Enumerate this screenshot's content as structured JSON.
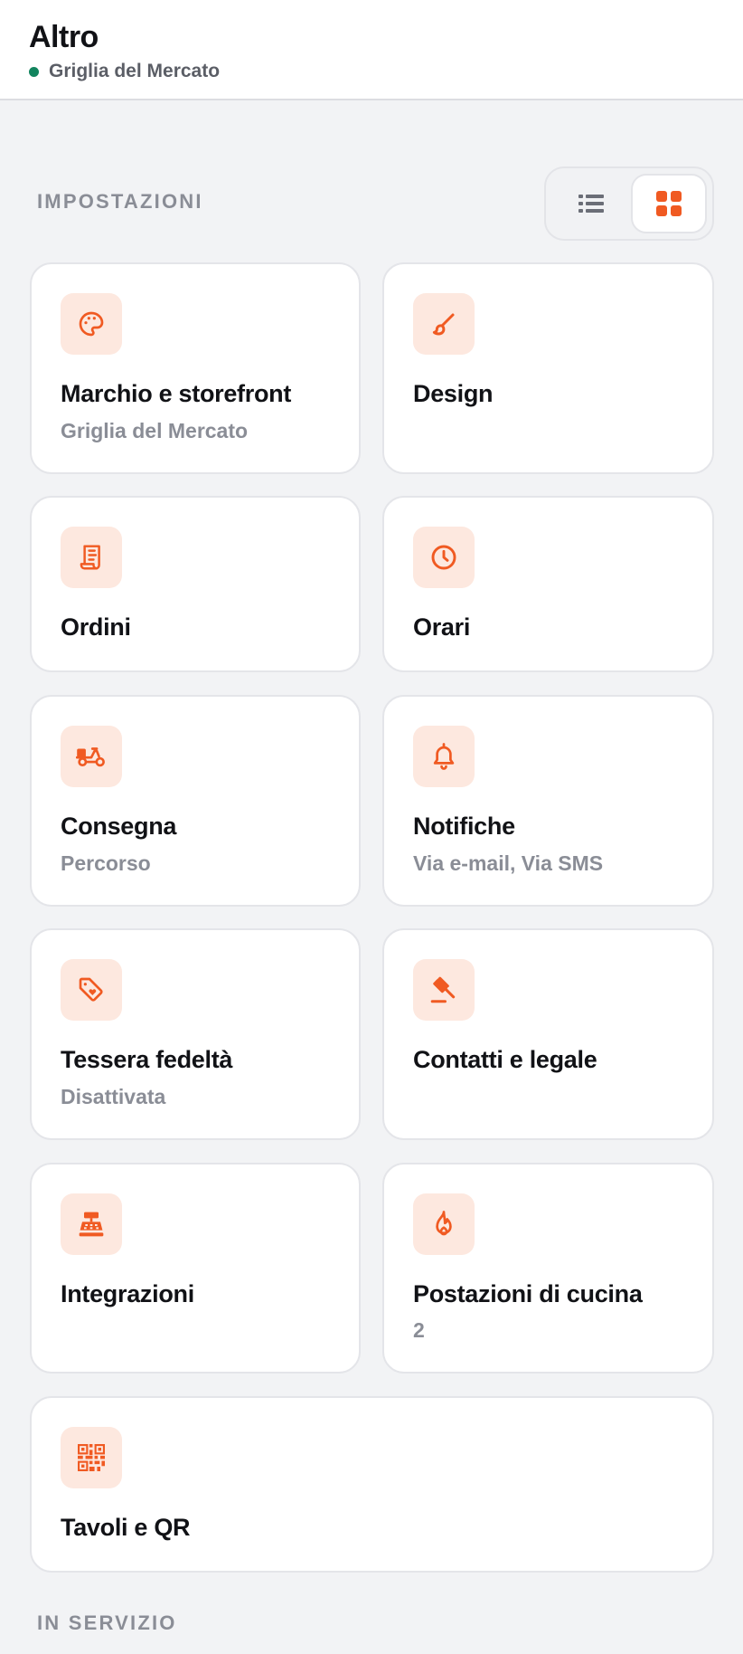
{
  "header": {
    "title": "Altro",
    "subtitle": "Griglia del Mercato",
    "status_color": "#12845e"
  },
  "sections": {
    "settings_label": "IMPOSTAZIONI",
    "in_service_label": "IN SERVIZIO"
  },
  "view_toggle": {
    "options": [
      "list",
      "grid"
    ],
    "selected": "grid"
  },
  "colors": {
    "accent": "#f05a22",
    "icon_bg": "#fde8df",
    "muted_text": "#8a8d96"
  },
  "cards": [
    {
      "title": "Marchio e storefront",
      "subtitle": "Griglia del Mercato",
      "icon": "palette-icon"
    },
    {
      "title": "Design",
      "subtitle": "",
      "icon": "brush-icon"
    },
    {
      "title": "Ordini",
      "subtitle": "",
      "icon": "receipt-icon"
    },
    {
      "title": "Orari",
      "subtitle": "",
      "icon": "clock-icon"
    },
    {
      "title": "Consegna",
      "subtitle": "Percorso",
      "icon": "scooter-icon"
    },
    {
      "title": "Notifiche",
      "subtitle": "Via e-mail, Via SMS",
      "icon": "bell-icon"
    },
    {
      "title": "Tessera fedeltà",
      "subtitle": "Disattivata",
      "icon": "tag-heart-icon"
    },
    {
      "title": "Contatti e legale",
      "subtitle": "",
      "icon": "gavel-icon"
    },
    {
      "title": "Integrazioni",
      "subtitle": "",
      "icon": "cash-register-icon"
    },
    {
      "title": "Postazioni di cucina",
      "subtitle": "2",
      "icon": "flame-icon"
    },
    {
      "title": "Tavoli e QR",
      "subtitle": "",
      "icon": "qr-code-icon"
    }
  ]
}
